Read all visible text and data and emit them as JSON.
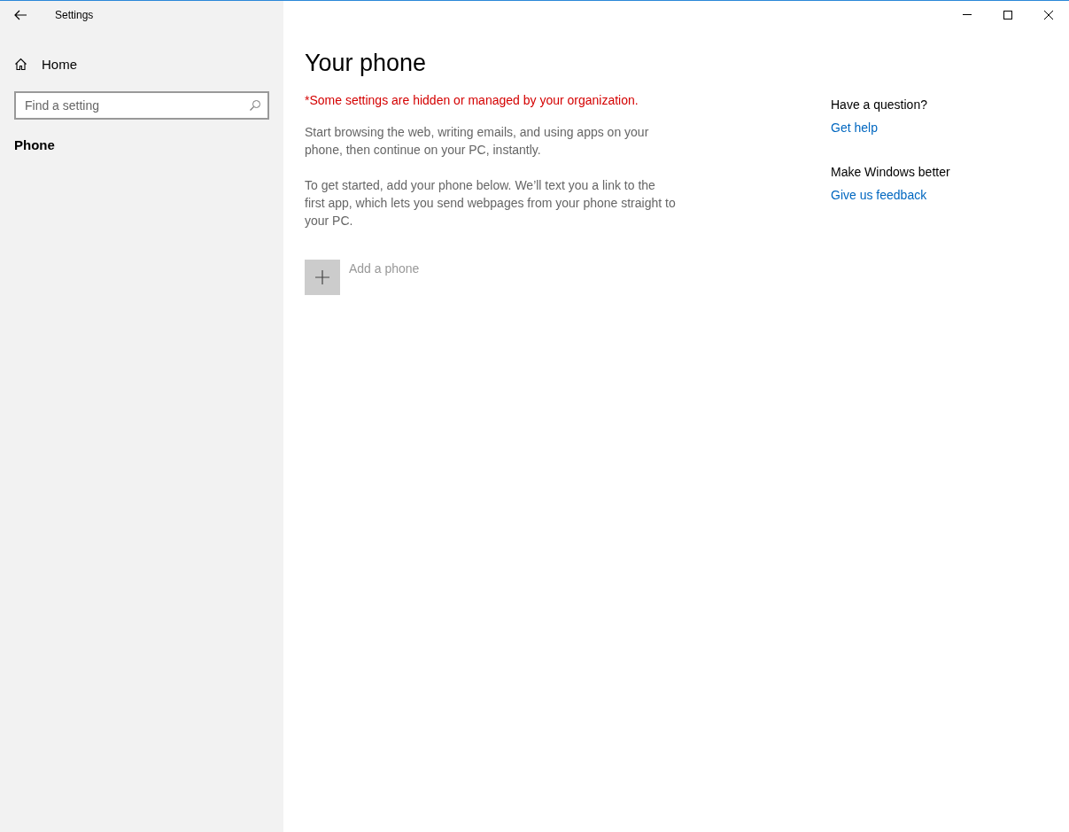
{
  "window": {
    "title": "Settings"
  },
  "sidebar": {
    "home": "Home",
    "search": {
      "placeholder": "Find a setting"
    },
    "items": [
      {
        "label": "Phone",
        "selected": true
      }
    ]
  },
  "page": {
    "title": "Your phone",
    "warning": "*Some settings are hidden or managed by your organization.",
    "paragraphs": [
      "Start browsing the web, writing emails, and using apps on your phone, then continue on your PC, instantly.",
      "To get started, add your phone below. We’ll text you a link to the first app, which lets you send webpages from your phone straight to your PC."
    ],
    "add_phone": {
      "label": "Add a phone",
      "disabled": true
    }
  },
  "aside": [
    {
      "heading": "Have a question?",
      "link": "Get help"
    },
    {
      "heading": "Make Windows better",
      "link": "Give us feedback"
    }
  ]
}
